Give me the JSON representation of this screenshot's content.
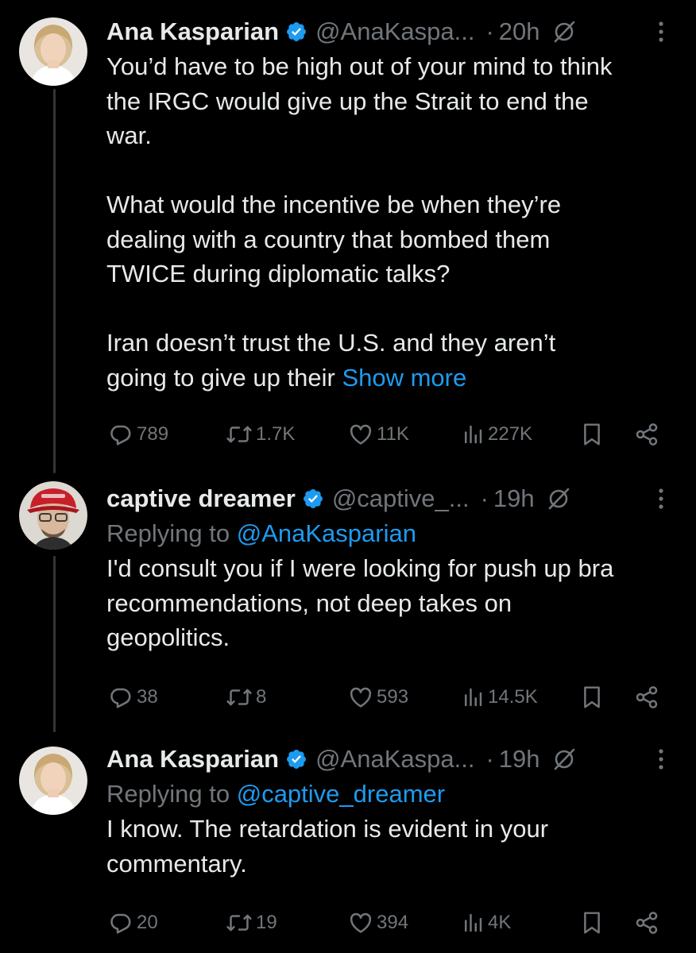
{
  "colors": {
    "background": "#000000",
    "text_primary": "#e7e9ea",
    "text_secondary": "#71767b",
    "link": "#1d9bf0",
    "verified": "#1d9bf0",
    "thread_line": "#333639"
  },
  "tweets": [
    {
      "display_name": "Ana Kasparian",
      "handle": "@AnaKaspa...",
      "separator": "·",
      "time": "20h",
      "verified_icon": "verified-badge-icon",
      "avatar": "avatar-ana-kasparian",
      "body": "You’d have to be high out of your mind to think\nthe IRGC would give up the Strait to end the\nwar.\n\nWhat would the incentive be when they’re\ndealing with a country that bombed them\nTWICE during diplomatic talks?\n\nIran doesn’t trust the U.S. and they aren’t\ngoing to give up their ",
      "show_more": "Show more",
      "replies": "789",
      "reposts": "1.7K",
      "likes": "11K",
      "views": "227K"
    },
    {
      "display_name": "captive dreamer",
      "handle": "@captive_...",
      "separator": "·",
      "time": "19h",
      "verified_icon": "verified-badge-icon",
      "avatar": "avatar-captive-dreamer",
      "replying_prefix": "Replying to ",
      "replying_to": "@AnaKasparian",
      "body": "I'd consult you if I were looking for push up bra\nrecommendations, not deep takes on\ngeopolitics.",
      "replies": "38",
      "reposts": "8",
      "likes": "593",
      "views": "14.5K"
    },
    {
      "display_name": "Ana Kasparian",
      "handle": "@AnaKaspa...",
      "separator": "·",
      "time": "19h",
      "verified_icon": "verified-badge-icon",
      "avatar": "avatar-ana-kasparian",
      "replying_prefix": "Replying to ",
      "replying_to": "@captive_dreamer",
      "body": "I know. The retardation is evident in your\ncommentary.",
      "replies": "20",
      "reposts": "19",
      "likes": "394",
      "views": "4K"
    }
  ]
}
